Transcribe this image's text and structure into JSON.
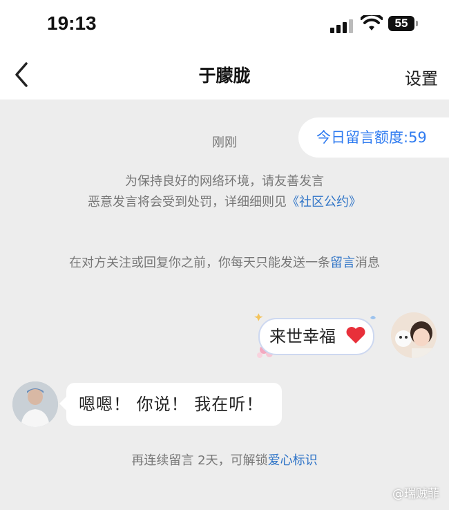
{
  "status_bar": {
    "time": "19:13",
    "battery": "55"
  },
  "nav": {
    "title": "于朦胧",
    "settings_label": "设置"
  },
  "quota_badge": "今日留言额度:59",
  "chat": {
    "timestamp": "刚刚",
    "notice_line1": "为保持良好的网络环境，请友善发言",
    "notice_line2_prefix": "恶意发言将会受到处罚，详细细则见",
    "notice_line2_link": "《社区公约》",
    "rule_prefix": "在对方关注或回复你之前，你每天只能发送一条",
    "rule_link": "留言",
    "rule_suffix": "消息",
    "messages": [
      {
        "sender": "me",
        "text": "来世幸福"
      },
      {
        "sender": "other",
        "text": "嗯嗯！ 你说！ 我在听！"
      }
    ],
    "unlock_prefix": "再连续留言 2天，可解锁",
    "unlock_link": "爱心标识"
  },
  "watermark": "@瑞贼菲",
  "colors": {
    "link": "#2f74c7",
    "quota_text": "#2f7bf0",
    "background": "#ededed",
    "heart": "#e8303a"
  }
}
